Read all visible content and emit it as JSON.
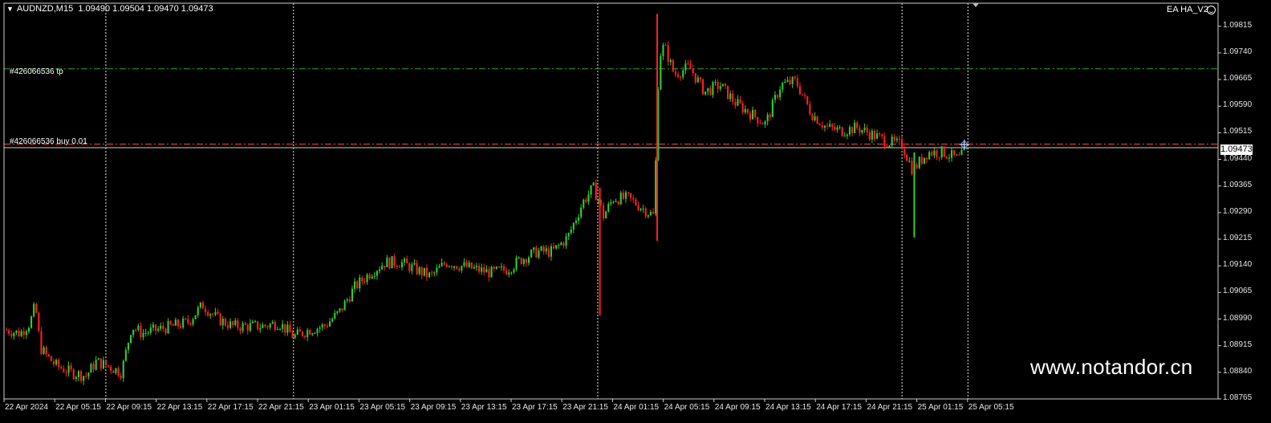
{
  "header": {
    "symbol": "AUDNZD,M15",
    "ohlc": "1.09490 1.09504 1.09470 1.09473",
    "expert_name": "EA HA_V2"
  },
  "orders": {
    "tp_label": "#426066536 tp",
    "tp_price": 1.09695,
    "buy_label": "#426066536 buy 0.01",
    "buy_price": 1.09483
  },
  "current_price": 1.09473,
  "current_price_label": "1.09473",
  "watermark": "www.notandor.cn",
  "colors": {
    "background": "#000000",
    "bull": "#32cd32",
    "bear": "#ff2020",
    "tp_line": "#22aa22",
    "buy_line": "#ff4040",
    "grid": "#ffffff"
  },
  "chart_data": {
    "type": "candlestick",
    "timeframe": "M15",
    "ylim": [
      1.08765,
      1.0988
    ],
    "y_ticks": [
      "1.09815",
      "1.09740",
      "1.09665",
      "1.09590",
      "1.09515",
      "1.09440",
      "1.09365",
      "1.09290",
      "1.09215",
      "1.09140",
      "1.09065",
      "1.08990",
      "1.08915",
      "1.08840",
      "1.08765"
    ],
    "x_ticks": [
      "22 Apr 2024",
      "22 Apr 05:15",
      "22 Apr 09:15",
      "22 Apr 13:15",
      "22 Apr 17:15",
      "22 Apr 21:15",
      "23 Apr 01:15",
      "23 Apr 05:15",
      "23 Apr 09:15",
      "23 Apr 13:15",
      "23 Apr 17:15",
      "23 Apr 21:15",
      "24 Apr 01:15",
      "24 Apr 05:15",
      "24 Apr 09:15",
      "24 Apr 13:15",
      "24 Apr 17:15",
      "24 Apr 21:15",
      "25 Apr 01:15",
      "25 Apr 05:15"
    ],
    "day_separators": [
      2,
      5.7,
      11.7,
      17.7,
      19
    ],
    "price_path": [
      [
        0,
        1.0896
      ],
      [
        0.3,
        1.0895
      ],
      [
        0.5,
        1.0898
      ],
      [
        0.6,
        1.0903
      ],
      [
        0.7,
        1.0891
      ],
      [
        0.8,
        1.0889
      ],
      [
        1.0,
        1.0886
      ],
      [
        1.3,
        1.0884
      ],
      [
        1.6,
        1.0883
      ],
      [
        1.8,
        1.0887
      ],
      [
        2.0,
        1.0886
      ],
      [
        2.3,
        1.0884
      ],
      [
        2.5,
        1.0897
      ],
      [
        2.7,
        1.0895
      ],
      [
        3.0,
        1.0896
      ],
      [
        3.3,
        1.0897
      ],
      [
        3.6,
        1.0898
      ],
      [
        3.9,
        1.0903
      ],
      [
        4.2,
        1.0899
      ],
      [
        4.5,
        1.0897
      ],
      [
        4.8,
        1.0897
      ],
      [
        5.1,
        1.0897
      ],
      [
        5.4,
        1.0898
      ],
      [
        5.7,
        1.0894
      ],
      [
        6.0,
        1.0896
      ],
      [
        6.3,
        1.0897
      ],
      [
        6.6,
        1.0901
      ],
      [
        6.9,
        1.0908
      ],
      [
        7.2,
        1.0912
      ],
      [
        7.5,
        1.0915
      ],
      [
        7.8,
        1.0915
      ],
      [
        8.1,
        1.0913
      ],
      [
        8.4,
        1.0911
      ],
      [
        8.7,
        1.0915
      ],
      [
        9.0,
        1.0914
      ],
      [
        9.3,
        1.0913
      ],
      [
        9.6,
        1.0912
      ],
      [
        9.9,
        1.0913
      ],
      [
        10.2,
        1.0916
      ],
      [
        10.5,
        1.0918
      ],
      [
        10.8,
        1.0918
      ],
      [
        11.1,
        1.0922
      ],
      [
        11.4,
        1.0932
      ],
      [
        11.6,
        1.0936
      ],
      [
        11.7,
        1.0933
      ],
      [
        11.8,
        1.0928
      ],
      [
        12.0,
        1.0933
      ],
      [
        12.3,
        1.0933
      ],
      [
        12.6,
        1.093
      ],
      [
        12.8,
        1.0928
      ],
      [
        12.9,
        1.0973
      ],
      [
        13.0,
        1.0976
      ],
      [
        13.2,
        1.0968
      ],
      [
        13.5,
        1.097
      ],
      [
        13.8,
        1.0963
      ],
      [
        14.1,
        1.0965
      ],
      [
        14.4,
        1.096
      ],
      [
        14.7,
        1.0957
      ],
      [
        15.0,
        1.0954
      ],
      [
        15.3,
        1.0965
      ],
      [
        15.6,
        1.0966
      ],
      [
        15.9,
        1.0957
      ],
      [
        16.2,
        1.0953
      ],
      [
        16.5,
        1.0952
      ],
      [
        16.8,
        1.0953
      ],
      [
        17.1,
        1.0951
      ],
      [
        17.4,
        1.0949
      ],
      [
        17.7,
        1.0948
      ],
      [
        17.9,
        1.0941
      ],
      [
        18.2,
        1.0946
      ],
      [
        18.5,
        1.0946
      ],
      [
        18.8,
        1.0944
      ],
      [
        19.0,
        1.0947
      ]
    ]
  }
}
